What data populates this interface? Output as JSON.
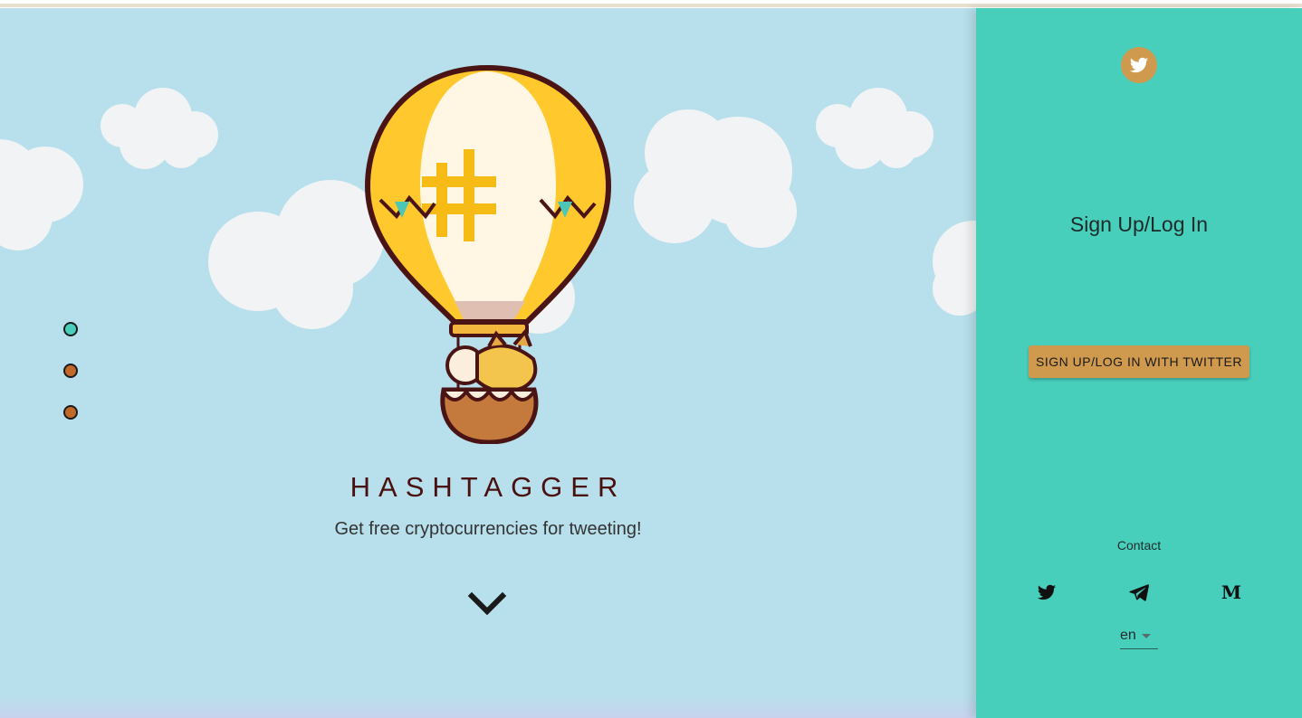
{
  "hero": {
    "brand": "HASHTAGGER",
    "tagline": "Get free cryptocurrencies for tweeting!",
    "background_color": "#b8e0ec",
    "scroll_icon": "chevron-down-icon",
    "slide_dots": [
      {
        "color": "#48cfbc",
        "active": true
      },
      {
        "color": "#c0692a",
        "active": false
      },
      {
        "color": "#c0692a",
        "active": false
      }
    ]
  },
  "panel": {
    "background_color": "#48cfbc",
    "logo_icon": "twitter-icon",
    "title": "Sign Up/Log In",
    "login_button": "SIGN UP/LOG IN WITH TWITTER",
    "button_color": "#cf9a4e",
    "contact_label": "Contact",
    "social_links": [
      "twitter-icon",
      "telegram-icon",
      "medium-icon"
    ],
    "language": {
      "selected": "en"
    }
  }
}
